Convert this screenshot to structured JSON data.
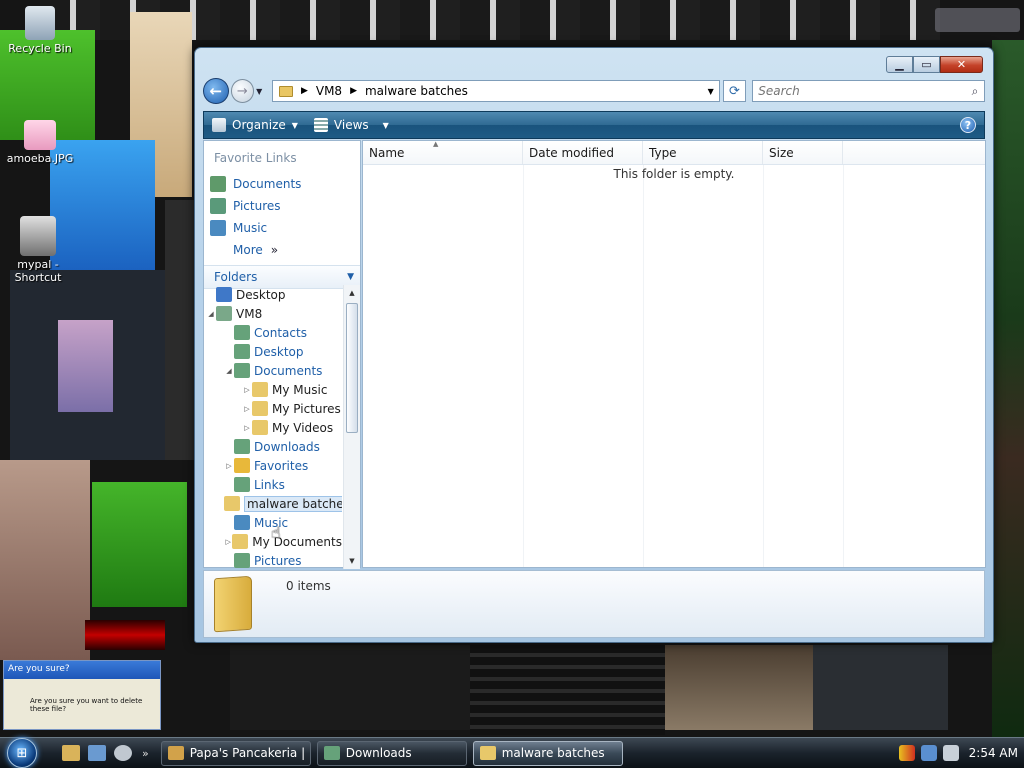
{
  "desktop": {
    "icons": [
      {
        "label": "Recycle Bin"
      },
      {
        "label": "amoeba.JPG"
      },
      {
        "label": "mypal - Shortcut"
      }
    ],
    "dialog_fragment": {
      "title": "Are you sure?",
      "text": "Are you sure you want to delete these file?"
    }
  },
  "window": {
    "title": "malware batches",
    "address": {
      "segments": [
        "VM8",
        "malware batches"
      ]
    },
    "search_placeholder": "Search",
    "toolbar": {
      "organize": "Organize",
      "views": "Views",
      "help": "?"
    },
    "favorite_links": {
      "heading": "Favorite Links",
      "items": [
        {
          "label": "Documents",
          "color": "#5f9a6a"
        },
        {
          "label": "Pictures",
          "color": "#5a9a7a"
        },
        {
          "label": "Music",
          "color": "#4a8ac0"
        },
        {
          "label": "More",
          "suffix": "»"
        }
      ]
    },
    "folders_heading": "Folders",
    "tree": [
      {
        "label": "Desktop",
        "indent": 0,
        "expander": "",
        "icon": "#3f78c8",
        "dark": true
      },
      {
        "label": "VM8",
        "indent": 0,
        "expander": "◢",
        "icon": "#7aa889",
        "dark": true
      },
      {
        "label": "Contacts",
        "indent": 1,
        "expander": "",
        "icon": "#66a27a"
      },
      {
        "label": "Desktop",
        "indent": 1,
        "expander": "",
        "icon": "#66a27a"
      },
      {
        "label": "Documents",
        "indent": 1,
        "expander": "◢",
        "icon": "#66a27a"
      },
      {
        "label": "My Music",
        "indent": 2,
        "expander": "▷",
        "icon": "#e8c86a",
        "dark": true
      },
      {
        "label": "My Pictures",
        "indent": 2,
        "expander": "▷",
        "icon": "#e8c86a",
        "dark": true
      },
      {
        "label": "My Videos",
        "indent": 2,
        "expander": "▷",
        "icon": "#e8c86a",
        "dark": true
      },
      {
        "label": "Downloads",
        "indent": 1,
        "expander": "",
        "icon": "#66a27a"
      },
      {
        "label": "Favorites",
        "indent": 1,
        "expander": "▷",
        "icon": "#e8b83a"
      },
      {
        "label": "Links",
        "indent": 1,
        "expander": "",
        "icon": "#66a27a"
      },
      {
        "label": "malware batches",
        "indent": 1,
        "expander": "",
        "icon": "#e8c86a",
        "selected": true
      },
      {
        "label": "Music",
        "indent": 1,
        "expander": "",
        "icon": "#4a8ac0"
      },
      {
        "label": "My Documents",
        "indent": 1,
        "expander": "▷",
        "icon": "#e8c86a",
        "dark": true
      },
      {
        "label": "Pictures",
        "indent": 1,
        "expander": "",
        "icon": "#66a27a"
      }
    ],
    "columns": [
      "Name",
      "Date modified",
      "Type",
      "Size"
    ],
    "empty_message": "This folder is empty.",
    "details": {
      "count": "0 items"
    }
  },
  "taskbar": {
    "tasks": [
      {
        "label": "Papa's Pancakeria | ...",
        "icon": "#d2a24a",
        "active": false
      },
      {
        "label": "Downloads",
        "icon": "#66a27a",
        "active": false
      },
      {
        "label": "malware batches",
        "icon": "#e8c86a",
        "active": true
      }
    ],
    "clock": "2:54 AM"
  }
}
